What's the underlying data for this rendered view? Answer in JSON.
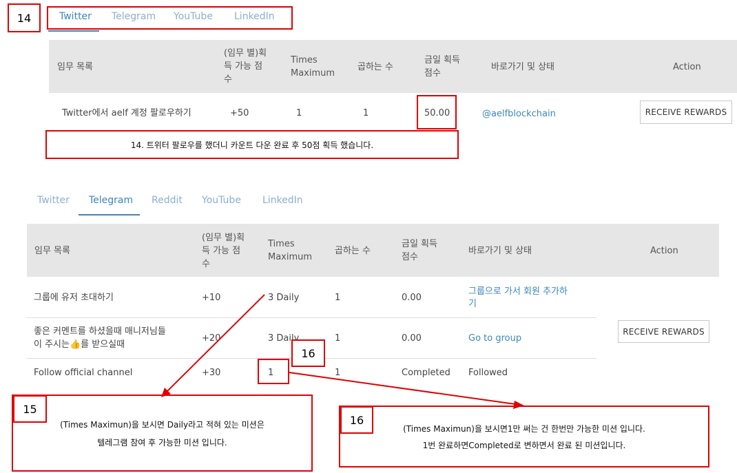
{
  "annotations": {
    "n14": "14",
    "n15": "15",
    "n16a": "16",
    "n16b": "16",
    "note14": "14. 트위터 팔로우를 했더니 카운트 다운 완료 후 50점 획득 했습니다.",
    "note15_line1": "(Times Maximun)을 보시면 Daily라고 적혀 있는 미션은",
    "note15_line2": "텔레그램 참여 후 가능한 미션 입니다.",
    "note16_line1": "(Times Maximun)을 보시면1만 써는 건 한번만 가능한 미션 입니다.",
    "note16_line2": "1번 완료하면Completed로 변하면서 완료 된 미션입니다.",
    "color": "#e00000"
  },
  "panel1": {
    "tabs": [
      "Twitter",
      "Telegram",
      "YouTube",
      "LinkedIn"
    ],
    "active_tab": "Twitter",
    "headers": {
      "mission": "임무 목록",
      "points_1": "(임무 별)획",
      "points_2": "득 가능 점",
      "points_3": "수",
      "times_1": "Times",
      "times_2": "Maximum",
      "multiplier": "곱하는 수",
      "today_1": "금일 획득",
      "today_2": "점수",
      "link": "바로가기 및 상태",
      "action": "Action"
    },
    "rows": [
      {
        "mission": "Twitter에서 aelf 계정 팔로우하기",
        "points": "+50",
        "times": "1",
        "multiplier": "1",
        "today": "50.00",
        "link": "@aelfblockchain",
        "button": "RECEIVE REWARDS"
      }
    ]
  },
  "panel2": {
    "tabs": [
      "Twitter",
      "Telegram",
      "Reddit",
      "YouTube",
      "LinkedIn"
    ],
    "active_tab": "Telegram",
    "headers": {
      "mission": "임무 목록",
      "points_1": "(임무 별)획",
      "points_2": "득 가능 점",
      "points_3": "수",
      "times_1": "Times",
      "times_2": "Maximum",
      "multiplier": "곱하는 수",
      "today_1": "금일 획득",
      "today_2": "점수",
      "link": "바로가기 및 상태",
      "action": "Action"
    },
    "rows": [
      {
        "mission": "그룹에 유저 초대하기",
        "points": "+10",
        "times": "3 Daily",
        "multiplier": "1",
        "today": "0.00",
        "link_1": "그룹으로 가서 회원 추가하",
        "link_2": "기"
      },
      {
        "mission_1": "좋은 커멘트를 하셨을때 매니저님들",
        "mission_2": "이 주시는👍를 받으실때",
        "points": "+20",
        "times": "3 Daily",
        "multiplier": "1",
        "today": "0.00",
        "link": "Go to group"
      },
      {
        "mission": "Follow official channel",
        "points": "+30",
        "times": "1",
        "multiplier": "1",
        "today": "Completed",
        "link": "Followed"
      }
    ],
    "button": "RECEIVE REWARDS"
  }
}
